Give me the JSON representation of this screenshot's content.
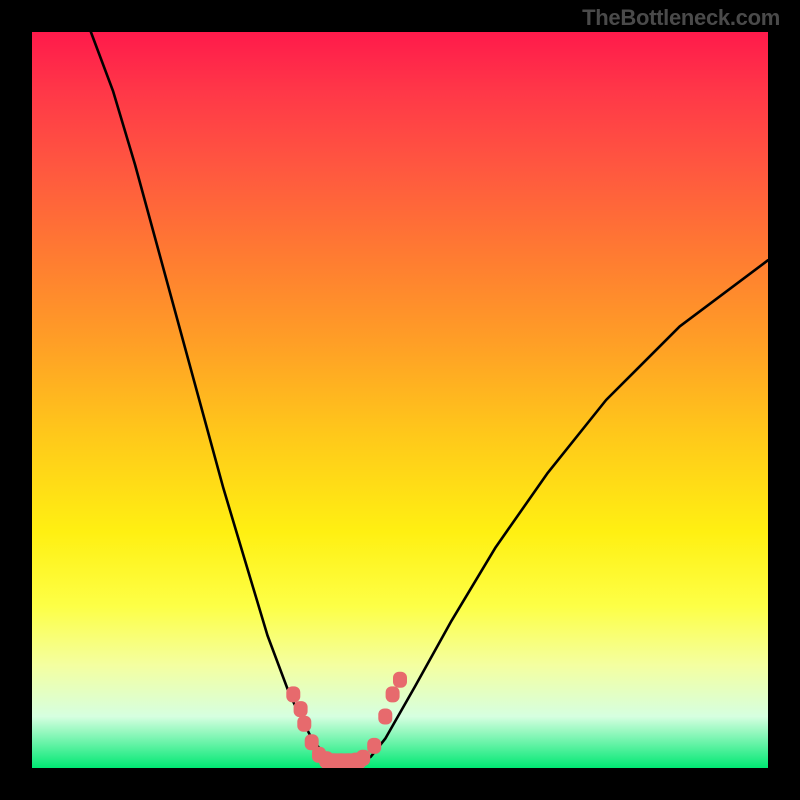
{
  "brand": "TheBottleneck.com",
  "colors": {
    "background": "#000000",
    "gradient_top": "#ff1a4b",
    "gradient_bottom": "#00e873",
    "curve": "#000000",
    "marker": "#e76a6d"
  },
  "chart_data": {
    "type": "line",
    "title": "",
    "xlabel": "",
    "ylabel": "",
    "xlim": [
      0,
      100
    ],
    "ylim": [
      0,
      100
    ],
    "grid": false,
    "legend": false,
    "series": [
      {
        "name": "curve",
        "points": [
          {
            "x": 8,
            "y": 100
          },
          {
            "x": 11,
            "y": 92
          },
          {
            "x": 14,
            "y": 82
          },
          {
            "x": 17,
            "y": 71
          },
          {
            "x": 20,
            "y": 60
          },
          {
            "x": 23,
            "y": 49
          },
          {
            "x": 26,
            "y": 38
          },
          {
            "x": 29,
            "y": 28
          },
          {
            "x": 32,
            "y": 18
          },
          {
            "x": 35,
            "y": 10
          },
          {
            "x": 38,
            "y": 4
          },
          {
            "x": 40,
            "y": 1.5
          },
          {
            "x": 43,
            "y": 0.8
          },
          {
            "x": 46,
            "y": 1.5
          },
          {
            "x": 48,
            "y": 4
          },
          {
            "x": 52,
            "y": 11
          },
          {
            "x": 57,
            "y": 20
          },
          {
            "x": 63,
            "y": 30
          },
          {
            "x": 70,
            "y": 40
          },
          {
            "x": 78,
            "y": 50
          },
          {
            "x": 88,
            "y": 60
          },
          {
            "x": 100,
            "y": 69
          }
        ]
      }
    ],
    "markers": [
      {
        "x": 35.5,
        "y": 10
      },
      {
        "x": 36.5,
        "y": 8
      },
      {
        "x": 37,
        "y": 6
      },
      {
        "x": 38,
        "y": 3.5
      },
      {
        "x": 39,
        "y": 1.8
      },
      {
        "x": 40,
        "y": 1.2
      },
      {
        "x": 41,
        "y": 0.9
      },
      {
        "x": 42,
        "y": 0.9
      },
      {
        "x": 43,
        "y": 0.9
      },
      {
        "x": 44,
        "y": 1.0
      },
      {
        "x": 45,
        "y": 1.4
      },
      {
        "x": 46.5,
        "y": 3
      },
      {
        "x": 48,
        "y": 7
      },
      {
        "x": 49,
        "y": 10
      },
      {
        "x": 50,
        "y": 12
      }
    ]
  }
}
